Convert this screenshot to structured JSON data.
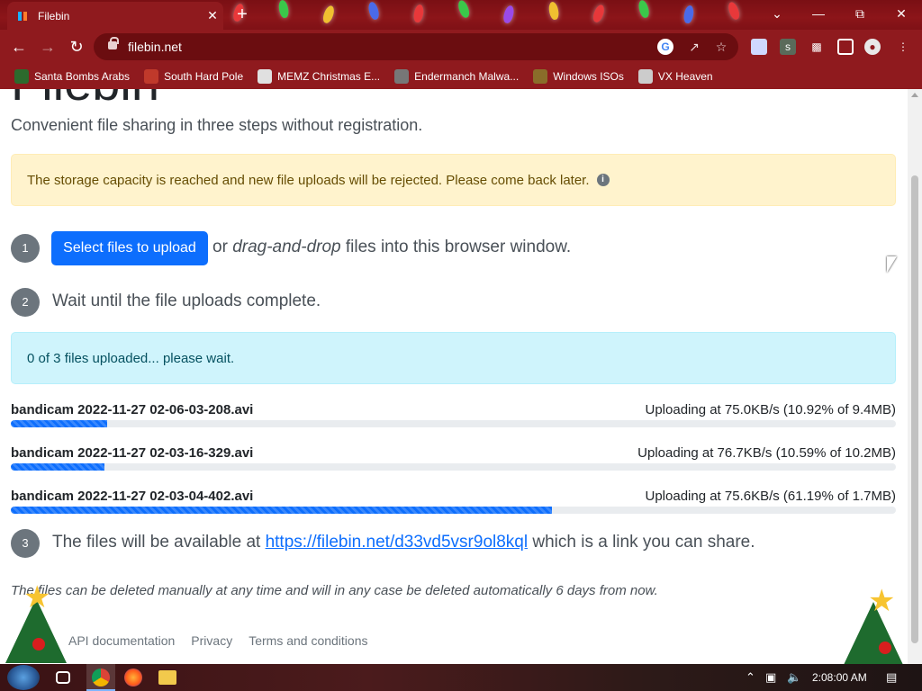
{
  "browser": {
    "tab_title": "Filebin",
    "url": "filebin.net",
    "tab_close_label": "✕",
    "new_tab_label": "+",
    "bookmarks": [
      {
        "label": "Santa Bombs Arabs",
        "icon_color": "#2d6a2d"
      },
      {
        "label": "South Hard Pole",
        "icon_color": "#c0392b"
      },
      {
        "label": "MEMZ Christmas E...",
        "icon_color": "#e0e0e0"
      },
      {
        "label": "Endermanch Malwa...",
        "icon_color": "#777777"
      },
      {
        "label": "Windows ISOs",
        "icon_color": "#8a6d2a"
      },
      {
        "label": "VX Heaven",
        "icon_color": "#cccccc"
      }
    ]
  },
  "page": {
    "tagline": "Convenient file sharing in three steps without registration.",
    "storage_alert": "The storage capacity is reached and new file uploads will be rejected. Please come back later.",
    "steps": {
      "step1_number": "1",
      "select_button": "Select files to upload",
      "step1_or": "or",
      "step1_dnd": "drag-and-drop",
      "step1_rest": "files into this browser window.",
      "step2_number": "2",
      "step2_text": "Wait until the file uploads complete.",
      "step3_number": "3",
      "step3_before": "The files will be available at",
      "share_url": "https://filebin.net/d33vd5vsr9ol8kql",
      "step3_after": "which is a link you can share."
    },
    "upload_status": "0 of 3 files uploaded... please wait.",
    "uploads": [
      {
        "name": "bandicam 2022-11-27 02-06-03-208.avi",
        "status": "Uploading at 75.0KB/s (10.92% of 9.4MB)",
        "progress_pct": 10.92
      },
      {
        "name": "bandicam 2022-11-27 02-03-16-329.avi",
        "status": "Uploading at 76.7KB/s (10.59% of 10.2MB)",
        "progress_pct": 10.59
      },
      {
        "name": "bandicam 2022-11-27 02-03-04-402.avi",
        "status": "Uploading at 75.6KB/s (61.19% of 1.7MB)",
        "progress_pct": 61.19
      }
    ],
    "deletion_note": "The files can be deleted manually at any time and will in any case be deleted automatically 6 days from now.",
    "footer_links": [
      "API documentation",
      "Privacy",
      "Terms and conditions"
    ]
  },
  "taskbar": {
    "clock": "2:08:00 AM"
  },
  "colors": {
    "chrome_red": "#8f1a1e",
    "primary_blue": "#0d6efd",
    "warning_bg": "#fff3cd",
    "info_bg": "#cff4fc"
  }
}
